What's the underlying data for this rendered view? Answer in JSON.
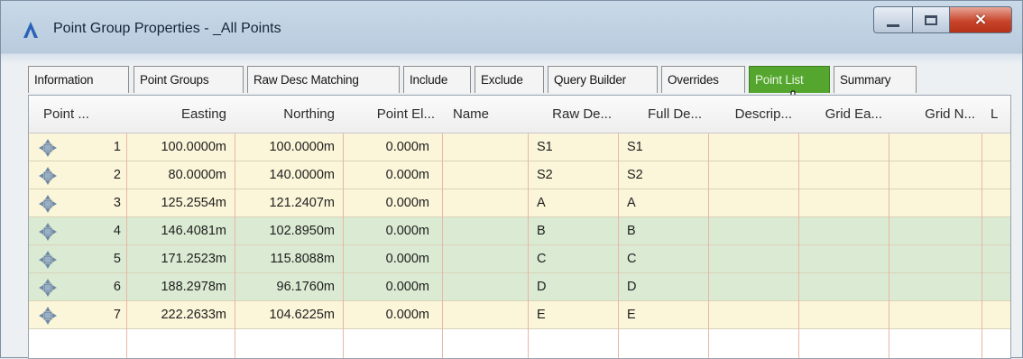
{
  "window": {
    "title": "Point Group Properties - _All Points",
    "icon": "civil3d-app-icon",
    "buttons": {
      "minimize": "minimize-icon",
      "maximize": "maximize-icon",
      "close": "×"
    }
  },
  "tabs": [
    {
      "label": "Information",
      "active": false
    },
    {
      "label": "Point Groups",
      "active": false
    },
    {
      "label": "Raw Desc Matching",
      "active": false
    },
    {
      "label": "Include",
      "active": false
    },
    {
      "label": "Exclude",
      "active": false
    },
    {
      "label": "Query Builder",
      "active": false
    },
    {
      "label": "Overrides",
      "active": false
    },
    {
      "label": "Point List",
      "active": true
    },
    {
      "label": "Summary",
      "active": false
    }
  ],
  "colors": {
    "active_tab": "#55a62f",
    "row_default": "#fbf6d9",
    "row_selected": "#dbebd3",
    "close_button": "#c8462c",
    "grid_lines": "#e9b6a4"
  },
  "table": {
    "columns": [
      "Point ...",
      "Easting",
      "Northing",
      "Point El...",
      "Name",
      "Raw De...",
      "Full De...",
      "Descrip...",
      "Grid Ea...",
      "Grid N...",
      "L"
    ],
    "rows": [
      {
        "point": "1",
        "easting": "100.0000m",
        "northing": "100.0000m",
        "elev": "0.000m",
        "name": "",
        "raw_desc": "S1",
        "full_desc": "S1",
        "selected": false
      },
      {
        "point": "2",
        "easting": "80.0000m",
        "northing": "140.0000m",
        "elev": "0.000m",
        "name": "",
        "raw_desc": "S2",
        "full_desc": "S2",
        "selected": false
      },
      {
        "point": "3",
        "easting": "125.2554m",
        "northing": "121.2407m",
        "elev": "0.000m",
        "name": "",
        "raw_desc": "A",
        "full_desc": "A",
        "selected": false
      },
      {
        "point": "4",
        "easting": "146.4081m",
        "northing": "102.8950m",
        "elev": "0.000m",
        "name": "",
        "raw_desc": "B",
        "full_desc": "B",
        "selected": true
      },
      {
        "point": "5",
        "easting": "171.2523m",
        "northing": "115.8088m",
        "elev": "0.000m",
        "name": "",
        "raw_desc": "C",
        "full_desc": "C",
        "selected": true
      },
      {
        "point": "6",
        "easting": "188.2978m",
        "northing": "96.1760m",
        "elev": "0.000m",
        "name": "",
        "raw_desc": "D",
        "full_desc": "D",
        "selected": true
      },
      {
        "point": "7",
        "easting": "222.2633m",
        "northing": "104.6225m",
        "elev": "0.000m",
        "name": "",
        "raw_desc": "E",
        "full_desc": "E",
        "selected": false
      }
    ]
  }
}
